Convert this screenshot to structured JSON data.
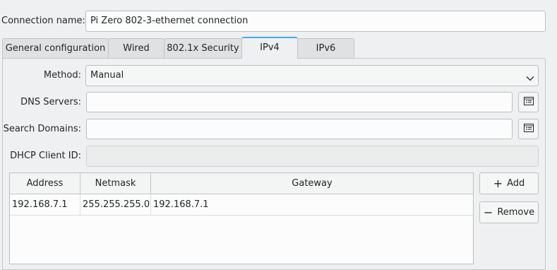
{
  "connection": {
    "name_label": "Connection name:",
    "name_value": "Pi Zero 802-3-ethernet connection"
  },
  "tabs": [
    {
      "label": "General configuration"
    },
    {
      "label": "Wired"
    },
    {
      "label": "802.1x Security"
    },
    {
      "label": "IPv4"
    },
    {
      "label": "IPv6"
    }
  ],
  "active_tab": "IPv4",
  "form": {
    "method_label": "Method:",
    "method_value": "Manual",
    "dns_label": "DNS Servers:",
    "dns_value": "",
    "search_label": "Search Domains:",
    "search_value": "",
    "dhcp_label": "DHCP Client ID:",
    "dhcp_value": ""
  },
  "table": {
    "headers": [
      "Address",
      "Netmask",
      "Gateway"
    ],
    "rows": [
      [
        "192.168.7.1",
        "255.255.255.0",
        "192.168.7.1"
      ]
    ]
  },
  "buttons": {
    "add_icon": "+",
    "add_label": "Add",
    "remove_icon": "−",
    "remove_label": "Remove"
  },
  "icons": {
    "list_edit": "list-edit-icon",
    "chevron": "chevron-down-icon"
  },
  "colors": {
    "accent": "#3daee9",
    "window_bg": "#eff0f1",
    "field_bg": "#fcfcfc"
  }
}
